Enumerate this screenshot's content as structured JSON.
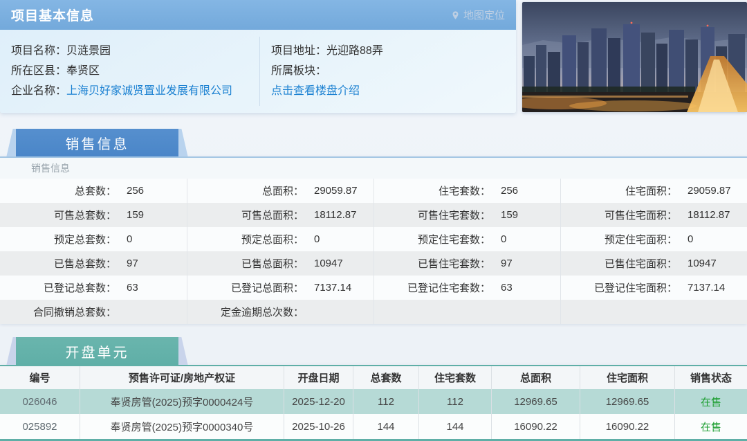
{
  "colors": {
    "header_blue": "#74aadc",
    "tab_blue": "#4a86c8",
    "tab_teal": "#5fafa7",
    "link_blue": "#1d82d2",
    "status_green": "#1d9e31",
    "row_teal": "#b6dad6"
  },
  "icons": {
    "map_link_icon": "map-pin-icon"
  },
  "basic": {
    "header": "项目基本信息",
    "map_link": "地图定位",
    "name_label": "项目名称：",
    "name_value": "贝涟景园",
    "district_label": "所在区县：",
    "district_value": "奉贤区",
    "company_label": "企业名称：",
    "company_value": "上海贝好家诚贤置业发展有限公司",
    "address_label": "项目地址：",
    "address_value": "光迎路88弄",
    "section_label": "所属板块：",
    "section_value": "",
    "intro_link": "点击查看楼盘介绍"
  },
  "sales": {
    "tab": "销售信息",
    "subtitle": "销售信息",
    "rows": [
      [
        {
          "l": "总套数：",
          "v": "256"
        },
        {
          "l": "总面积：",
          "v": "29059.87"
        },
        {
          "l": "住宅套数：",
          "v": "256"
        },
        {
          "l": "住宅面积：",
          "v": "29059.87"
        }
      ],
      [
        {
          "l": "可售总套数：",
          "v": "159"
        },
        {
          "l": "可售总面积：",
          "v": "18112.87"
        },
        {
          "l": "可售住宅套数：",
          "v": "159"
        },
        {
          "l": "可售住宅面积：",
          "v": "18112.87"
        }
      ],
      [
        {
          "l": "预定总套数：",
          "v": "0"
        },
        {
          "l": "预定总面积：",
          "v": "0"
        },
        {
          "l": "预定住宅套数：",
          "v": "0"
        },
        {
          "l": "预定住宅面积：",
          "v": "0"
        }
      ],
      [
        {
          "l": "已售总套数：",
          "v": "97"
        },
        {
          "l": "已售总面积：",
          "v": "10947"
        },
        {
          "l": "已售住宅套数：",
          "v": "97"
        },
        {
          "l": "已售住宅面积：",
          "v": "10947"
        }
      ],
      [
        {
          "l": "已登记总套数：",
          "v": "63"
        },
        {
          "l": "已登记总面积：",
          "v": "7137.14"
        },
        {
          "l": "已登记住宅套数：",
          "v": "63"
        },
        {
          "l": "已登记住宅面积：",
          "v": "7137.14"
        }
      ],
      [
        {
          "l": "合同撤销总套数：",
          "v": ""
        },
        {
          "l": "定金逾期总次数：",
          "v": ""
        },
        {
          "l": "",
          "v": ""
        },
        {
          "l": "",
          "v": ""
        }
      ]
    ]
  },
  "opening": {
    "tab": "开盘单元",
    "headers": [
      "编号",
      "预售许可证/房地产权证",
      "开盘日期",
      "总套数",
      "住宅套数",
      "总面积",
      "住宅面积",
      "销售状态"
    ],
    "rows": [
      [
        "026046",
        "奉贤房管(2025)预字0000424号",
        "2025-12-20",
        "112",
        "112",
        "12969.65",
        "12969.65",
        "在售"
      ],
      [
        "025892",
        "奉贤房管(2025)预字0000340号",
        "2025-10-26",
        "144",
        "144",
        "16090.22",
        "16090.22",
        "在售"
      ]
    ]
  }
}
